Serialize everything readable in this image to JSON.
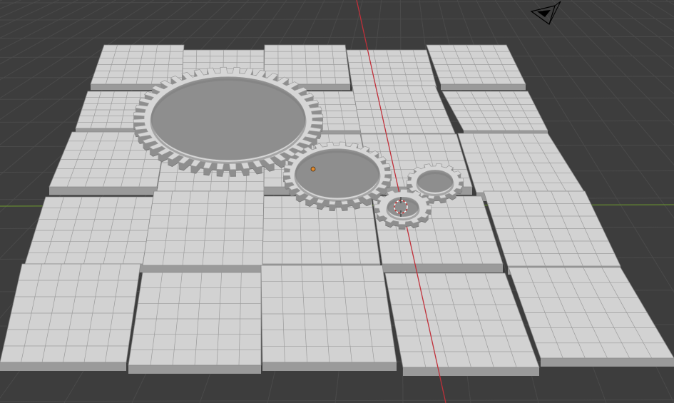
{
  "viewport": {
    "mode": "3d-viewport",
    "background_color": "#3d3d3d",
    "grid_color": "#4a4a4a",
    "x_axis_color": "#c0303a",
    "y_axis_color": "#6e9b2e",
    "tile_top_color": "#d2d2d2",
    "tile_side_color": "#9a9a9a",
    "tile_line_color": "#9c9c9c",
    "gear_color": "#d6d6d6",
    "gear_shadow_color": "#8e8e8e",
    "origin_color": "#e08a30",
    "camera_color": "#000000"
  },
  "scene": {
    "objects": [
      {
        "name": "floor-tiles",
        "count": 25
      },
      {
        "name": "gear-large-ring",
        "teeth": 44
      },
      {
        "name": "gear-medium-ring",
        "teeth": 26
      },
      {
        "name": "gear-small-ring",
        "teeth": 14
      },
      {
        "name": "gear-small",
        "teeth": 12
      }
    ]
  }
}
